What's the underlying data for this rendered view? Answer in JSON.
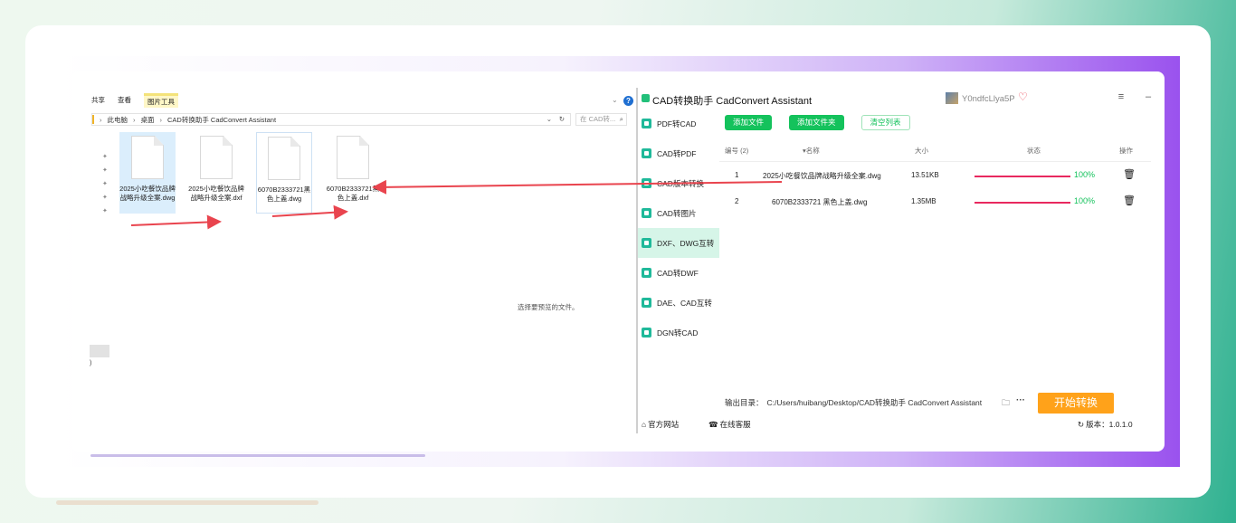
{
  "explorer": {
    "ribbon_tabs": [
      "共享",
      "查看",
      "图片工具"
    ],
    "address": {
      "segments": [
        "此电脑",
        "桌面",
        "CAD转换助手 CadConvert Assistant"
      ]
    },
    "search_placeholder": "在 CAD转...",
    "files": [
      {
        "name": "2025小吃餐饮品牌战略升级全案.dwg"
      },
      {
        "name": "2025小吃餐饮品牌战略升级全案.dxf"
      },
      {
        "name": "6070B2333721黑色上盖.dwg"
      },
      {
        "name": "6070B2333721黑色上盖.dxf"
      }
    ],
    "preview_message": "选择要预览的文件。",
    "paren_text": ")"
  },
  "app": {
    "title": "CAD转换助手 CadConvert Assistant",
    "user": {
      "name": "Y0ndfcLlya5P"
    },
    "sidebar": [
      {
        "label": "PDF转CAD"
      },
      {
        "label": "CAD转PDF"
      },
      {
        "label": "CAD版本转换"
      },
      {
        "label": "CAD转图片"
      },
      {
        "label": "DXF、DWG互转"
      },
      {
        "label": "CAD转DWF"
      },
      {
        "label": "DAE、CAD互转"
      },
      {
        "label": "DGN转CAD"
      }
    ],
    "toolbar": {
      "add_file": "添加文件",
      "add_folder": "添加文件夹",
      "clear_list": "清空列表"
    },
    "table": {
      "headers": {
        "index": "编号 (2)",
        "name": "▾名称",
        "size": "大小",
        "status": "状态",
        "action": "操作"
      },
      "rows": [
        {
          "index": "1",
          "name": "2025小吃餐饮品牌战略升级全案.dwg",
          "size": "13.51KB",
          "progress": 1.0,
          "percent": "100%"
        },
        {
          "index": "2",
          "name": "6070B2333721 黑色上盖.dwg",
          "size": "1.35MB",
          "progress": 1.0,
          "percent": "100%"
        }
      ]
    },
    "output": {
      "label": "输出目录：",
      "path": "C:/Users/huibang/Desktop/CAD转换助手 CadConvert Assistant"
    },
    "start_button": "开始转换",
    "footer": {
      "website": "官方网站",
      "support": "在线客服",
      "version": "版本：1.0.1.0"
    }
  },
  "colors": {
    "accent_green": "#14c25c",
    "progress_red": "#e8285f",
    "start_orange": "#ffa21a",
    "arrow_red": "#e9444e"
  }
}
